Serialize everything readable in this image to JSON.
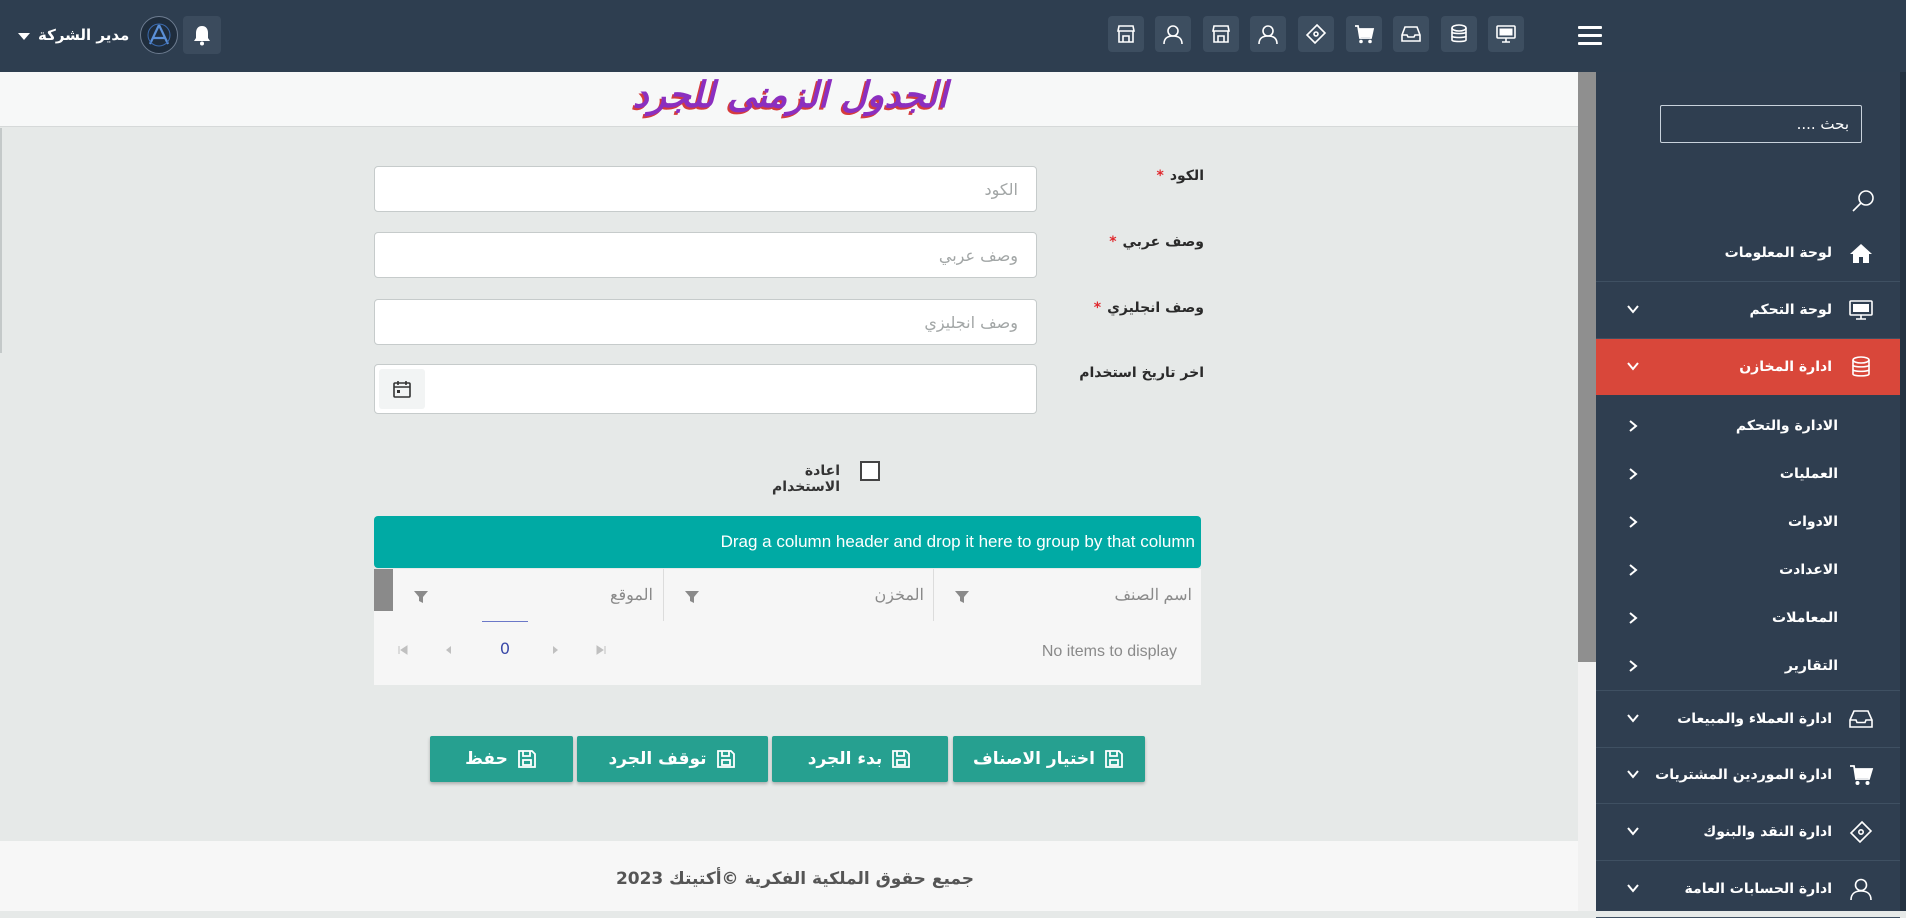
{
  "topbar": {
    "user_name": "مدير الشركة",
    "icons": [
      "monitor-icon",
      "database-icon",
      "inbox-icon",
      "cart-icon",
      "ticket-icon",
      "user-icon",
      "store-icon",
      "user-icon",
      "store-icon"
    ]
  },
  "page": {
    "title": "الجدول الزمنى للجرد"
  },
  "sidebar": {
    "search_placeholder": "بحث ....",
    "items": [
      {
        "label": "لوحة المعلومات",
        "icon": "home-icon"
      },
      {
        "label": "لوحة التحكم",
        "icon": "monitor-icon"
      },
      {
        "label": "ادارة المخازن",
        "icon": "database-icon",
        "active": true
      },
      {
        "label": "ادارة العملاء والمبيعات",
        "icon": "inbox-icon"
      },
      {
        "label": "ادارة الموردين المشتريات",
        "icon": "cart-icon"
      },
      {
        "label": "ادارة النقد والبنوك",
        "icon": "ticket-icon"
      },
      {
        "label": "ادارة الحسابات العامة",
        "icon": "user-icon"
      }
    ],
    "subitems": [
      "الادارة والتحكم",
      "العمليات",
      "الادوات",
      "الاعدادت",
      "المعاملات",
      "التقارير"
    ],
    "active_color": "#d9473a"
  },
  "form": {
    "code": {
      "label": "الكود",
      "required": "*",
      "placeholder": "الكود"
    },
    "desc_ar": {
      "label": "وصف عربي",
      "required": "*",
      "placeholder": "وصف عربي"
    },
    "desc_en": {
      "label": "وصف انجليزي",
      "required": "*",
      "placeholder": "وصف انجليزي"
    },
    "last_date": {
      "label": "اخر تاريخ استخدام"
    },
    "reuse": {
      "label": "اعادة الاستخدام",
      "checked": false
    }
  },
  "grid": {
    "group_hint": "Drag a column header and drop it here to group by that column",
    "columns": [
      "اسم الصنف",
      "المخزن",
      "الموقع"
    ],
    "empty_text": "No items to display",
    "page": "0",
    "accent": "#00aaa4"
  },
  "buttons": {
    "select_items": "اختيار الاصناف",
    "start": "بدء الجرد",
    "stop": "توقف الجرد",
    "save": "حفظ",
    "color": "#26a090"
  },
  "footer": {
    "text": "جميع حقوق الملكية الفكرية ©أكتيتك 2023"
  }
}
